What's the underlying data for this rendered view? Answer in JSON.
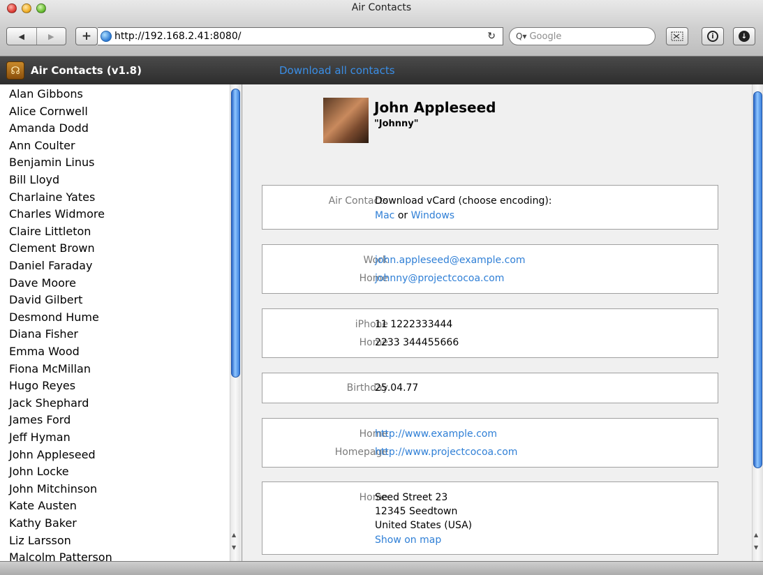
{
  "window": {
    "title": "Air Contacts"
  },
  "toolbar": {
    "back": "◀",
    "forward": "▶",
    "add": "+",
    "url": "http://192.168.2.41:8080/",
    "reload": "↻",
    "search_placeholder": "Google",
    "search_icon": "Q▾"
  },
  "app": {
    "title": "Air Contacts (v1.8)",
    "download_all": "Download all contacts"
  },
  "contacts": [
    "Alan Gibbons",
    "Alice Cornwell",
    "Amanda Dodd",
    "Ann Coulter",
    "Benjamin Linus",
    "Bill Lloyd",
    "Charlaine Yates",
    "Charles Widmore",
    "Claire Littleton",
    "Clement Brown",
    "Daniel Faraday",
    "Dave Moore",
    "David Gilbert",
    "Desmond Hume",
    "Diana Fisher",
    "Emma Wood",
    "Fiona McMillan",
    "Hugo Reyes",
    "Jack Shephard",
    "James Ford",
    "Jeff Hyman",
    "John Appleseed",
    "John Locke",
    "John Mitchinson",
    "Kate Austen",
    "Kathy Baker",
    "Liz Larsson",
    "Malcolm Patterson"
  ],
  "detail": {
    "name": "John Appleseed",
    "nickname": "\"Johnny\"",
    "vcard": {
      "label": "Air Contacts",
      "text": "Download vCard (choose encoding):",
      "mac": "Mac",
      "or": "or",
      "windows": "Windows"
    },
    "emails": [
      {
        "label": "Work",
        "value": "john.appleseed@example.com"
      },
      {
        "label": "Home",
        "value": "johnny@projectcocoa.com"
      }
    ],
    "phones": [
      {
        "label": "iPhone",
        "value": "11 1222333444"
      },
      {
        "label": "Home",
        "value": "2233 344455666"
      }
    ],
    "birthday": {
      "label": "Birthday",
      "value": "25.04.77"
    },
    "urls": [
      {
        "label": "Home",
        "value": "http://www.example.com"
      },
      {
        "label": "Homepage",
        "value": "http://www.projectcocoa.com"
      }
    ],
    "address": {
      "label": "Home",
      "street": "Seed Street 23",
      "city": "12345 Seedtown",
      "country": "United States (USA)",
      "map_link": "Show on map"
    }
  },
  "colors": {
    "link": "#2f7fd6",
    "header_bg": "#333333",
    "label_gray": "#7a7a7a"
  }
}
